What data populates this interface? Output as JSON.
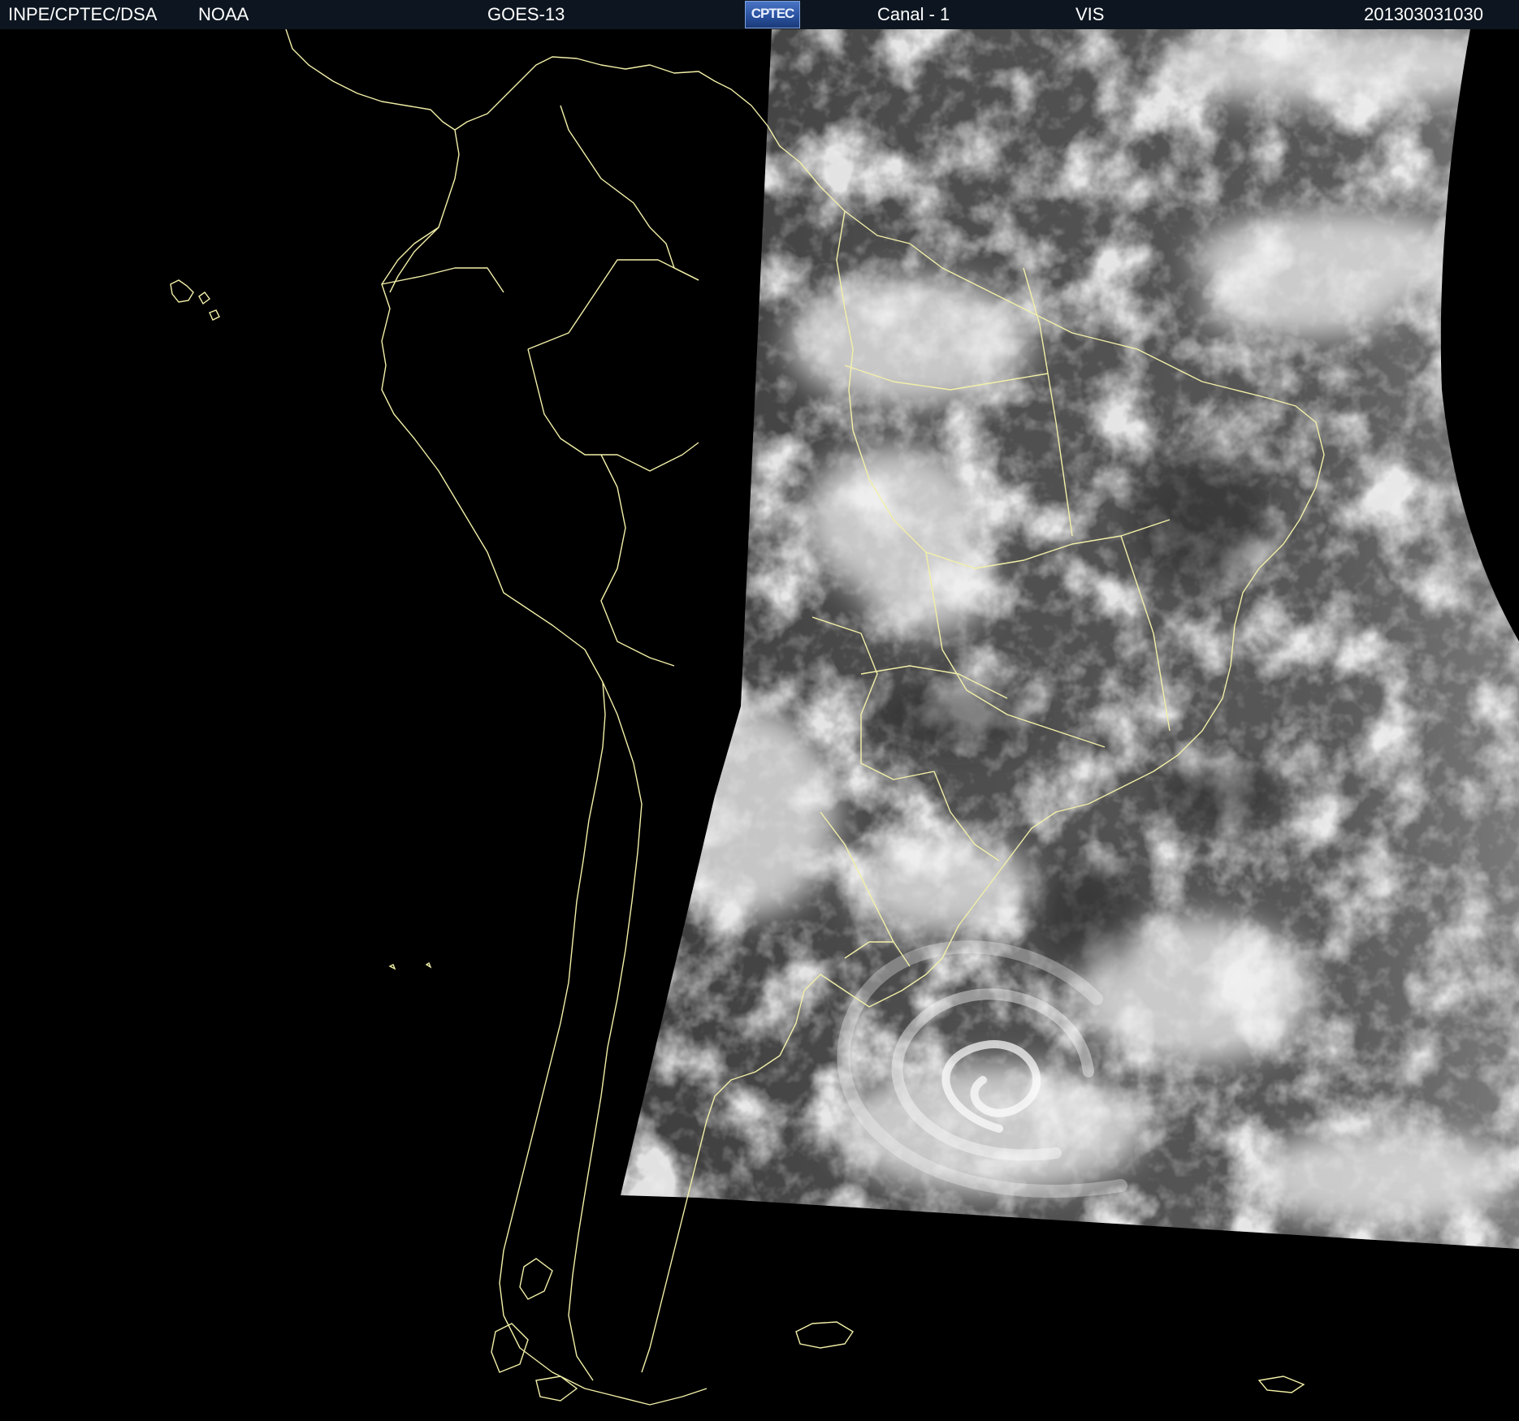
{
  "header": {
    "institution": "INPE/CPTEC/DSA",
    "agency": "NOAA",
    "satellite": "GOES-13",
    "logo_text": "CPTEC",
    "channel": "Canal - 1",
    "band": "VIS",
    "timestamp": "201303031030"
  },
  "colors": {
    "header_background": "#0d1620",
    "header_text": "#ffffff",
    "background": "#000000",
    "coastline": "#f2f0a8",
    "cloud_highlight": "#f4f4f4",
    "ocean_gray": "#5a5a5a"
  }
}
